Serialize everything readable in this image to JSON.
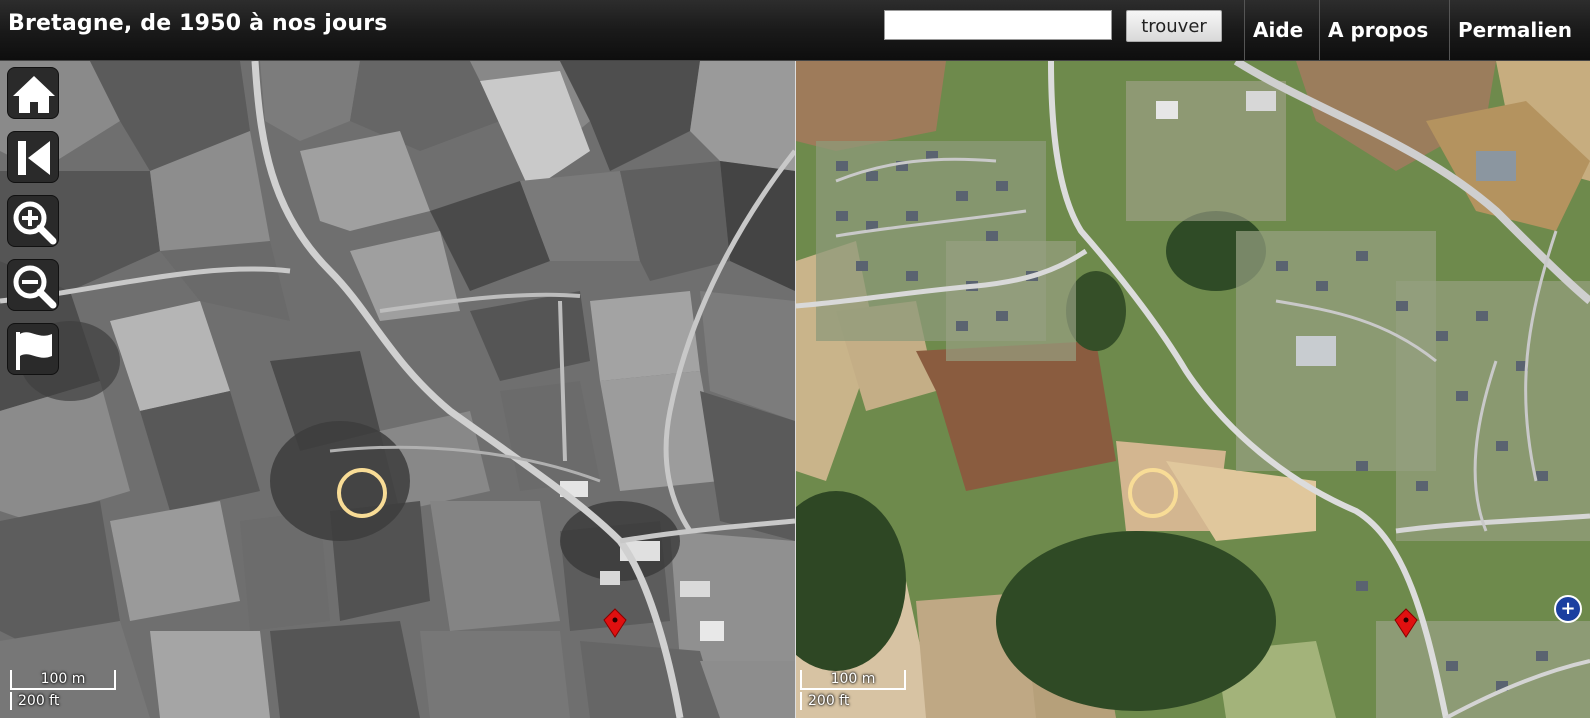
{
  "header": {
    "title": "Bretagne, de 1950 à nos jours",
    "search": {
      "value": "",
      "placeholder": ""
    },
    "search_button_label": "trouver",
    "nav": {
      "aide": "Aide",
      "apropos": "A propos",
      "permalien": "Permalien"
    }
  },
  "toolbar": [
    {
      "name": "home-icon"
    },
    {
      "name": "previous-extent-icon"
    },
    {
      "name": "zoom-in-icon"
    },
    {
      "name": "zoom-out-icon"
    },
    {
      "name": "flag-icon"
    }
  ],
  "scale_bars": {
    "left": {
      "metric": "100 m",
      "imperial": "200 ft"
    },
    "right": {
      "metric": "100 m",
      "imperial": "200 ft"
    }
  },
  "maps": {
    "left": {
      "imagery": "historical-1950-black-and-white-aerial"
    },
    "right": {
      "imagery": "present-day-color-aerial"
    }
  },
  "colors": {
    "marker_ring": "#f8dc96",
    "pin": "#e01010",
    "badge": "#1b3fa0",
    "header_bg": "#1a1a1a"
  }
}
